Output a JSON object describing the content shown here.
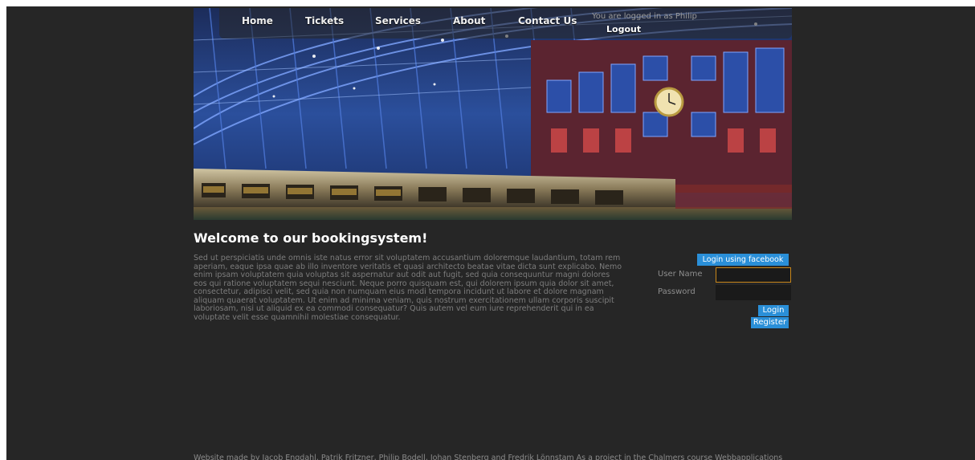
{
  "nav": {
    "items": [
      {
        "label": "Home"
      },
      {
        "label": "Tickets"
      },
      {
        "label": "Services"
      },
      {
        "label": "About"
      },
      {
        "label": "Contact Us"
      }
    ],
    "status_text": "You are logged in as Philip",
    "logout_label": "Logout"
  },
  "banner": {
    "subject": "train-station-hall-photo"
  },
  "main": {
    "heading": "Welcome to our bookingsystem!",
    "body": "Sed ut perspiciatis unde omnis iste natus error sit voluptatem accusantium doloremque laudantium, totam rem aperiam, eaque ipsa quae ab illo inventore veritatis et quasi architecto beatae vitae dicta sunt explicabo. Nemo enim ipsam voluptatem quia voluptas sit aspernatur aut odit aut fugit, sed quia consequuntur magni dolores eos qui ratione voluptatem sequi nesciunt. Neque porro quisquam est, qui dolorem ipsum quia dolor sit amet, consectetur, adipisci velit, sed quia non numquam eius modi tempora incidunt ut labore et dolore magnam aliquam quaerat voluptatem. Ut enim ad minima veniam, quis nostrum exercitationem ullam corporis suscipit laboriosam, nisi ut aliquid ex ea commodi consequatur? Quis autem vel eum iure reprehenderit qui in ea voluptate velit esse quamnihil molestiae consequatur."
  },
  "login": {
    "facebook_label": "Login using facebook",
    "username_label": "User Name",
    "username_value": "",
    "password_label": "Password",
    "password_value": "",
    "login_label": "Login",
    "register_label": "Register"
  },
  "footer": {
    "text": "Website made by Jacob Engdahl, Patrik Fritzner, Philip Bodell, Johan Stenberg and Fredrik Lönnstam As a project in the Chalmers course Webbapplications"
  },
  "colors": {
    "background": "#262626",
    "accent": "#2a8fd8",
    "focus_border": "#c8861a"
  }
}
